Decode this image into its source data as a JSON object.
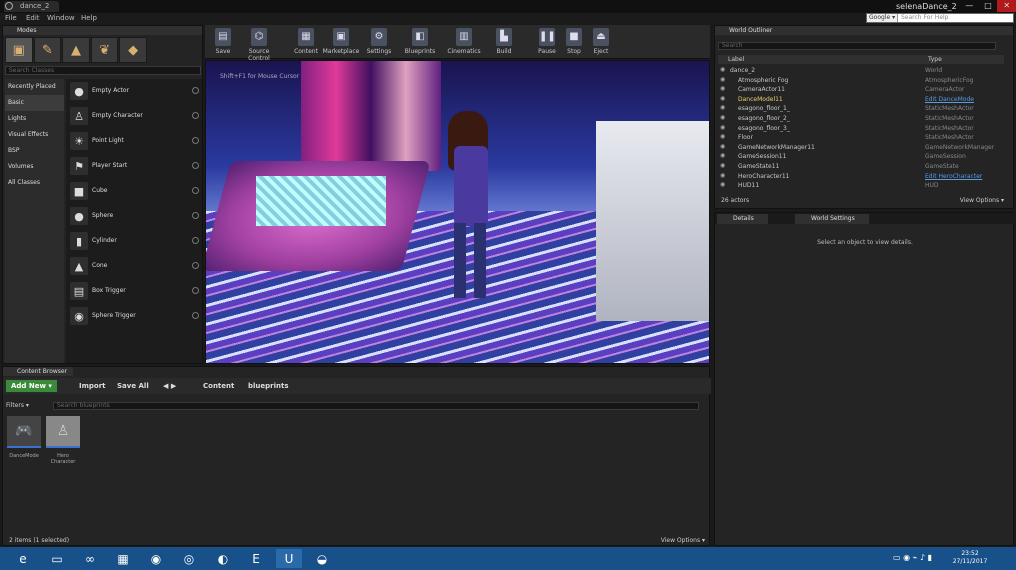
{
  "window": {
    "tab_title": "dance_2",
    "project_name": "selenaDance_2",
    "controls": [
      "—",
      "□",
      "✕"
    ]
  },
  "menu": [
    "File",
    "Edit",
    "Window",
    "Help"
  ],
  "google_search": {
    "engine": "Google ▾",
    "placeholder": "Search For Help"
  },
  "modes": {
    "tab_label": "Modes",
    "search_placeholder": "Search Classes",
    "categories": [
      "Recently Placed",
      "Basic",
      "Lights",
      "Visual Effects",
      "BSP",
      "Volumes",
      "All Classes"
    ],
    "selected_category": "Basic",
    "items": [
      "Empty Actor",
      "Empty Character",
      "Point Light",
      "Player Start",
      "Cube",
      "Sphere",
      "Cylinder",
      "Cone",
      "Box Trigger",
      "Sphere Trigger"
    ]
  },
  "toolbar": [
    {
      "label": "Save",
      "icon": "save-icon"
    },
    {
      "label": "Source Control",
      "icon": "source-control-icon"
    },
    {
      "label": "Content",
      "icon": "content-icon"
    },
    {
      "label": "Marketplace",
      "icon": "marketplace-icon"
    },
    {
      "label": "Settings",
      "icon": "settings-icon"
    },
    {
      "label": "Blueprints",
      "icon": "blueprints-icon"
    },
    {
      "label": "Cinematics",
      "icon": "cinematics-icon"
    },
    {
      "label": "Build",
      "icon": "build-icon"
    },
    {
      "label": "Pause",
      "icon": "pause-icon"
    },
    {
      "label": "Stop",
      "icon": "stop-icon"
    },
    {
      "label": "Eject",
      "icon": "eject-icon"
    }
  ],
  "viewport": {
    "overlay": "Shift+F1 for Mouse Cursor"
  },
  "outliner": {
    "tab_label": "World Outliner",
    "search_placeholder": "Search",
    "col_label": "Label",
    "col_type": "Type",
    "rows": [
      {
        "label": "dance_2",
        "type": "World",
        "link": false,
        "indent": 0
      },
      {
        "label": "Atmospheric Fog",
        "type": "AtmosphericFog",
        "link": false,
        "indent": 1
      },
      {
        "label": "CameraActor11",
        "type": "CameraActor",
        "link": false,
        "indent": 1
      },
      {
        "label": "DanceModel11",
        "type": "Edit DanceMode",
        "link": true,
        "indent": 1
      },
      {
        "label": "esagono_floor_1_",
        "type": "StaticMeshActor",
        "link": false,
        "indent": 1
      },
      {
        "label": "esagono_floor_2_",
        "type": "StaticMeshActor",
        "link": false,
        "indent": 1
      },
      {
        "label": "esagono_floor_3_",
        "type": "StaticMeshActor",
        "link": false,
        "indent": 1
      },
      {
        "label": "Floor",
        "type": "StaticMeshActor",
        "link": false,
        "indent": 1
      },
      {
        "label": "GameNetworkManager11",
        "type": "GameNetworkManager",
        "link": false,
        "indent": 1
      },
      {
        "label": "GameSession11",
        "type": "GameSession",
        "link": false,
        "indent": 1
      },
      {
        "label": "GameState11",
        "type": "GameState",
        "link": false,
        "indent": 1
      },
      {
        "label": "HeroCharacter11",
        "type": "Edit HeroCharacter",
        "link": true,
        "indent": 1
      },
      {
        "label": "HUD11",
        "type": "HUD",
        "link": false,
        "indent": 1
      }
    ],
    "actor_count": "26 actors",
    "view_options": "View Options ▾"
  },
  "details": {
    "tab_details": "Details",
    "tab_world_settings": "World Settings",
    "message": "Select an object to view details."
  },
  "content_browser": {
    "tab_label": "Content Browser",
    "add_new": "Add New ▾",
    "import": "Import",
    "save_all": "Save All",
    "crumbs": [
      "Content",
      "blueprints"
    ],
    "filters": "Filters ▾",
    "search_placeholder": "Search blueprints",
    "assets": [
      {
        "label": "DanceMode",
        "icon": "gamepad-icon"
      },
      {
        "label": "Hero Character",
        "icon": "character-icon"
      }
    ],
    "status": "2 items (1 selected)",
    "view_options": "View Options ▾"
  },
  "taskbar": {
    "apps": [
      "ie",
      "explorer",
      "vs",
      "app4",
      "firefox",
      "nvidia",
      "blender",
      "epic",
      "unreal",
      "gimp"
    ],
    "time": "23:52",
    "date": "27/11/2017"
  }
}
